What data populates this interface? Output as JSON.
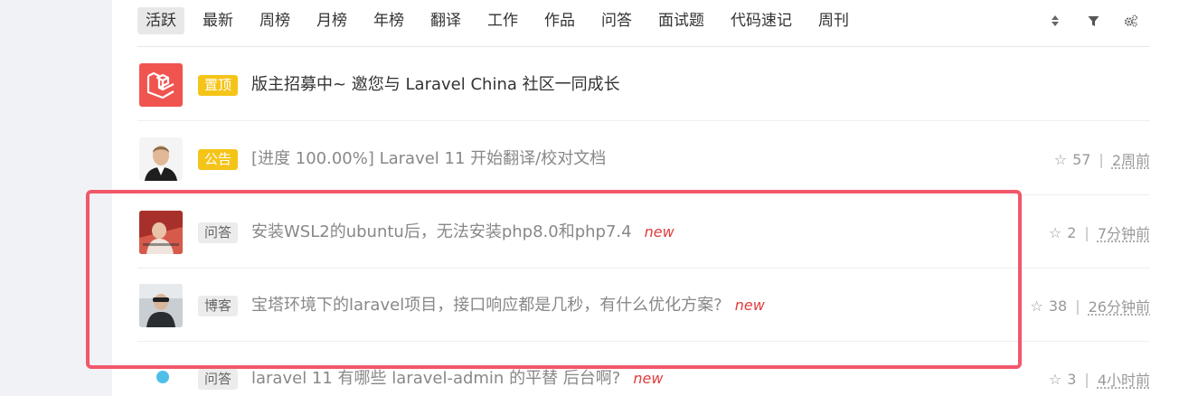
{
  "tabs": [
    {
      "label": "活跃",
      "active": true
    },
    {
      "label": "最新"
    },
    {
      "label": "周榜"
    },
    {
      "label": "月榜"
    },
    {
      "label": "年榜"
    },
    {
      "label": "翻译"
    },
    {
      "label": "工作"
    },
    {
      "label": "作品"
    },
    {
      "label": "问答"
    },
    {
      "label": "面试题"
    },
    {
      "label": "代码速记"
    },
    {
      "label": "周刊"
    }
  ],
  "tools": {
    "sort_icon": "sort-icon",
    "filter_icon": "filter-icon",
    "settings_icon": "gears-icon"
  },
  "topics": [
    {
      "badge": "置顶",
      "badge_style": "yellow",
      "title": "版主招募中~ 邀您与 Laravel China 社区一同成长",
      "avatar": "laravel-logo"
    },
    {
      "badge": "公告",
      "badge_style": "yellow",
      "title": "[进度 100.00%] Laravel 11 开始翻译/校对文档",
      "stars": "57",
      "time": "2周前",
      "avatar": "user-photo"
    },
    {
      "badge": "问答",
      "badge_style": "gray",
      "title": "安装WSL2的ubuntu后，无法安装php8.0和php7.4",
      "new": "new",
      "stars": "2",
      "time": "7分钟前",
      "avatar": "user-photo"
    },
    {
      "badge": "博客",
      "badge_style": "gray",
      "title": "宝塔环境下的laravel项目，接口响应都是几秒，有什么优化方案?",
      "new": "new",
      "stars": "38",
      "time": "26分钟前",
      "avatar": "user-photo"
    },
    {
      "badge": "问答",
      "badge_style": "gray",
      "title": "laravel 11 有哪些 laravel-admin 的平替 后台啊?",
      "new": "new",
      "stars": "3",
      "time": "4小时前",
      "avatar": "status-dot"
    }
  ],
  "colors": {
    "badge_yellow": "#f5c419",
    "highlight_border": "#f2576a",
    "new_tag": "#e03d3d",
    "laravel_red": "#f0544f"
  }
}
